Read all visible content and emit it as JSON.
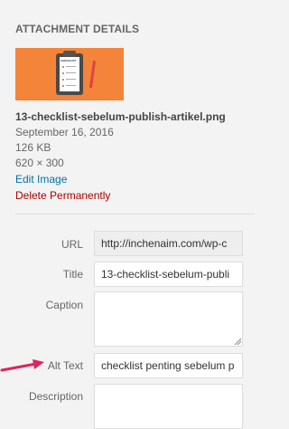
{
  "panel": {
    "heading": "ATTACHMENT DETAILS",
    "thumbnail_text": "CHECKLIST"
  },
  "file": {
    "name": "13-checklist-sebelum-publish-artikel.png",
    "date": "September 16, 2016",
    "size": "126 KB",
    "dimensions": "620 × 300",
    "edit_label": "Edit Image",
    "delete_label": "Delete Permanently"
  },
  "fields": {
    "url_label": "URL",
    "url_value": "http://inchenaim.com/wp-c",
    "title_label": "Title",
    "title_value": "13-checklist-sebelum-publi",
    "caption_label": "Caption",
    "caption_value": "",
    "alt_label": "Alt Text",
    "alt_value": "checklist penting sebelum p",
    "description_label": "Description",
    "description_value": ""
  },
  "colors": {
    "link": "#0073aa",
    "delete": "#aa0000",
    "arrow": "#e0245e",
    "thumbnail_bg": "#f3843a"
  }
}
